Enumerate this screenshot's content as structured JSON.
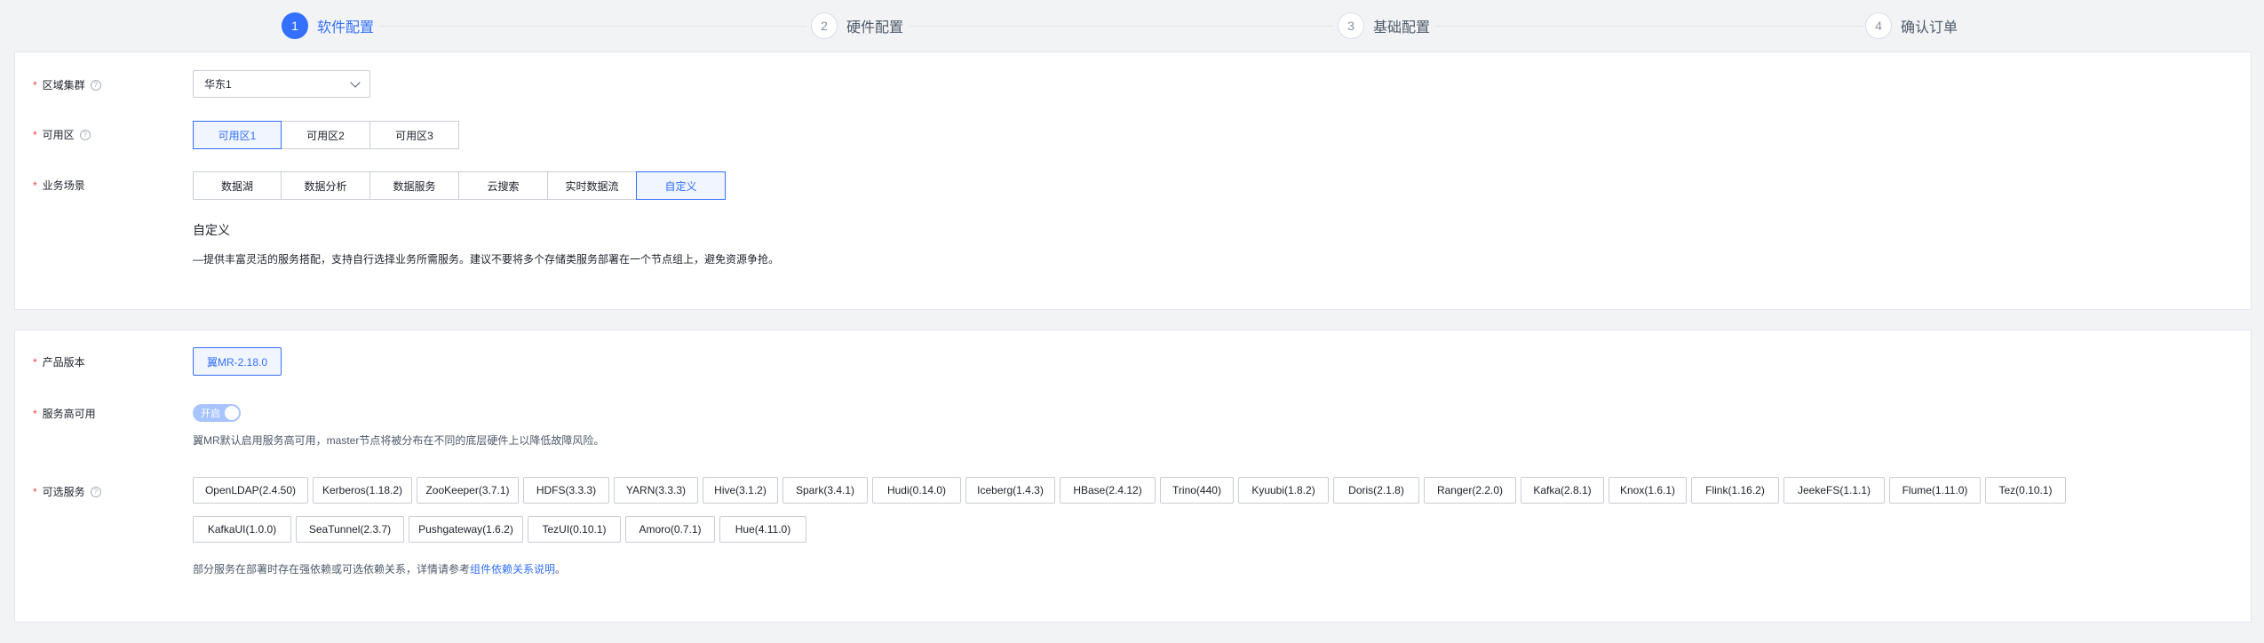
{
  "steps": [
    {
      "num": "1",
      "label": "软件配置",
      "active": true
    },
    {
      "num": "2",
      "label": "硬件配置",
      "active": false
    },
    {
      "num": "3",
      "label": "基础配置",
      "active": false
    },
    {
      "num": "4",
      "label": "确认订单",
      "active": false
    }
  ],
  "region": {
    "label": "区域集群",
    "value": "华东1"
  },
  "zone": {
    "label": "可用区",
    "options": [
      "可用区1",
      "可用区2",
      "可用区3"
    ],
    "selected": "可用区1"
  },
  "scenario": {
    "label": "业务场景",
    "options": [
      "数据湖",
      "数据分析",
      "数据服务",
      "云搜索",
      "实时数据流",
      "自定义"
    ],
    "selected": "自定义",
    "desc_title": "自定义",
    "desc_text": "—提供丰富灵活的服务搭配，支持自行选择业务所需服务。建议不要将多个存储类服务部署在一个节点组上，避免资源争抢。"
  },
  "product": {
    "label": "产品版本",
    "value": "翼MR-2.18.0"
  },
  "ha": {
    "label": "服务高可用",
    "toggle_text": "开启",
    "desc": "翼MR默认启用服务高可用，master节点将被分布在不同的底层硬件上以降低故障风险。"
  },
  "services": {
    "label": "可选服务",
    "row1": [
      "OpenLDAP(2.4.50)",
      "Kerberos(1.18.2)",
      "ZooKeeper(3.7.1)",
      "HDFS(3.3.3)",
      "YARN(3.3.3)",
      "Hive(3.1.2)",
      "Spark(3.4.1)",
      "Hudi(0.14.0)",
      "Iceberg(1.4.3)",
      "HBase(2.4.12)",
      "Trino(440)",
      "Kyuubi(1.8.2)",
      "Doris(2.1.8)",
      "Ranger(2.2.0)",
      "Kafka(2.8.1)",
      "Knox(1.6.1)",
      "Flink(1.16.2)",
      "JeekeFS(1.1.1)",
      "Flume(1.11.0)",
      "Tez(0.10.1)"
    ],
    "row2": [
      "KafkaUI(1.0.0)",
      "SeaTunnel(2.3.7)",
      "Pushgateway(1.6.2)",
      "TezUI(0.10.1)",
      "Amoro(0.7.1)",
      "Hue(4.11.0)"
    ],
    "note_prefix": "部分服务在部署时存在强依赖或可选依赖关系，详情请参考",
    "note_link": "组件依赖关系说明",
    "note_suffix": "。"
  },
  "colors": {
    "accent": "#3370ff",
    "required": "#f53f3f"
  }
}
